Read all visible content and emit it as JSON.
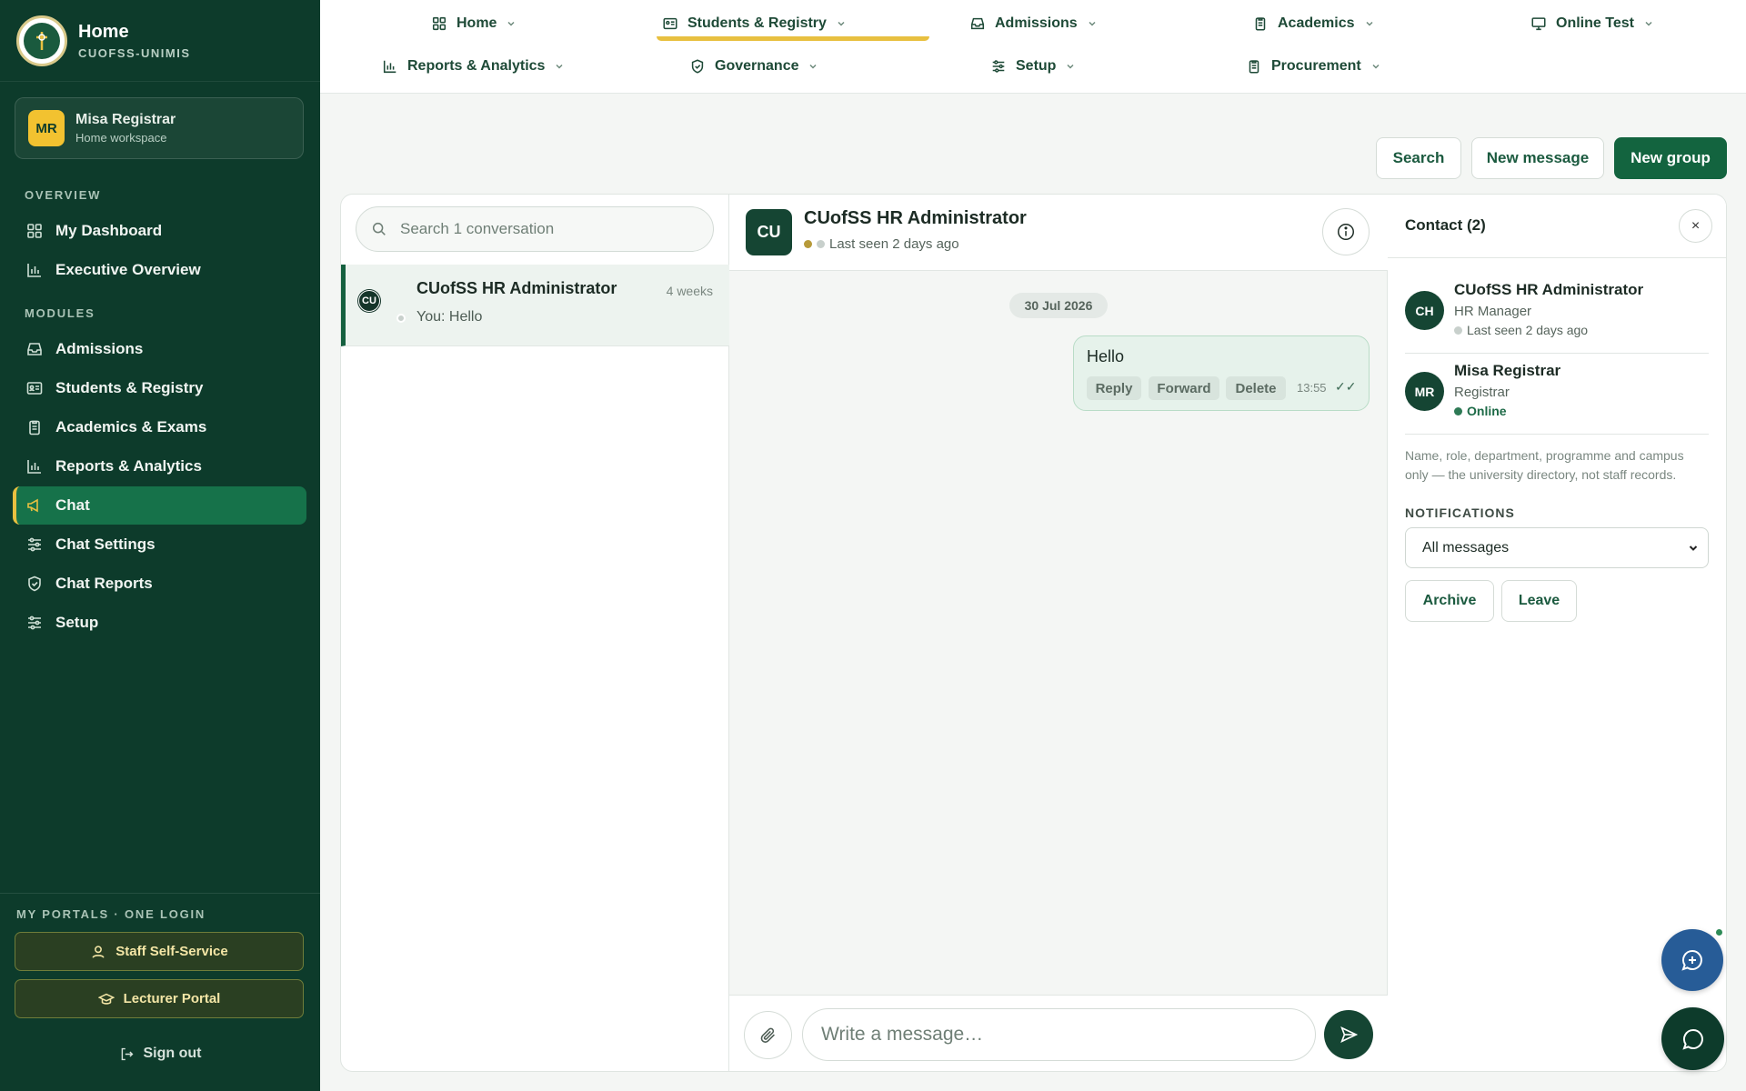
{
  "app": {
    "title": "Home",
    "subtitle": "CUOFSS-UNIMIS"
  },
  "user": {
    "initials": "MR",
    "name": "Misa Registrar",
    "workspace": "Home workspace"
  },
  "sidebar": {
    "overview_label": "OVERVIEW",
    "overview_items": [
      {
        "label": "My Dashboard",
        "icon": "grid-icon"
      },
      {
        "label": "Executive Overview",
        "icon": "bar-chart-icon"
      }
    ],
    "modules_label": "MODULES",
    "module_items": [
      {
        "label": "Admissions",
        "icon": "inbox-icon"
      },
      {
        "label": "Students & Registry",
        "icon": "id-card-icon"
      },
      {
        "label": "Academics & Exams",
        "icon": "clipboard-icon"
      },
      {
        "label": "Reports & Analytics",
        "icon": "bar-chart-icon"
      },
      {
        "label": "Chat",
        "icon": "megaphone-icon",
        "active": true
      },
      {
        "label": "Chat Settings",
        "icon": "sliders-icon"
      },
      {
        "label": "Chat Reports",
        "icon": "shield-icon"
      },
      {
        "label": "Setup",
        "icon": "sliders-icon"
      }
    ],
    "portals_label": "MY PORTALS · ONE LOGIN",
    "portals": [
      {
        "label": "Staff Self-Service",
        "icon": "user-icon"
      },
      {
        "label": "Lecturer Portal",
        "icon": "graduation-cap-icon"
      }
    ],
    "signout": "Sign out"
  },
  "topnav": [
    {
      "label": "Home",
      "icon": "grid-icon",
      "active": true
    },
    {
      "label": "Students & Registry",
      "icon": "id-card-icon"
    },
    {
      "label": "Admissions",
      "icon": "inbox-icon"
    },
    {
      "label": "Academics",
      "icon": "clipboard-icon"
    },
    {
      "label": "Online Test",
      "icon": "monitor-icon"
    },
    {
      "label": "Reports & Analytics",
      "icon": "bar-chart-icon"
    },
    {
      "label": "Governance",
      "icon": "shield-icon"
    },
    {
      "label": "Setup",
      "icon": "sliders-icon"
    },
    {
      "label": "Procurement",
      "icon": "clipboard-icon"
    }
  ],
  "actions": {
    "search": "Search",
    "new_message": "New message",
    "new_group": "New group"
  },
  "conversations": {
    "search_placeholder": "Search 1 conversation",
    "items": [
      {
        "avatar": "CU",
        "name": "CUofSS HR Administrator",
        "time": "4 weeks",
        "preview": "You: Hello"
      }
    ]
  },
  "chat": {
    "avatar": "CU",
    "name": "CUofSS HR Administrator",
    "status": "Last seen 2 days ago",
    "date": "30 Jul 2026",
    "message": {
      "text": "Hello",
      "time": "13:55",
      "ticks": "✓✓",
      "reply": "Reply",
      "forward": "Forward",
      "delete": "Delete"
    },
    "input_placeholder": "Write a message…"
  },
  "info_panel": {
    "title": "Contact (2)",
    "close": "×",
    "contacts": [
      {
        "initials": "CH",
        "name": "CUofSS HR Administrator",
        "role": "HR Manager",
        "status": "Last seen 2 days ago"
      },
      {
        "initials": "MR",
        "name": "Misa Registrar",
        "role": "Registrar",
        "status": "Online"
      }
    ],
    "note": "Name, role, department, programme and campus only — the university directory, not staff records.",
    "notifications_label": "NOTIFICATIONS",
    "notifications_value": "All messages",
    "archive": "Archive",
    "leave": "Leave"
  },
  "colors": {
    "sidebar": "#0d3b2b",
    "accent": "#e8c040",
    "primary": "#13643f",
    "fab": "#275c97"
  }
}
